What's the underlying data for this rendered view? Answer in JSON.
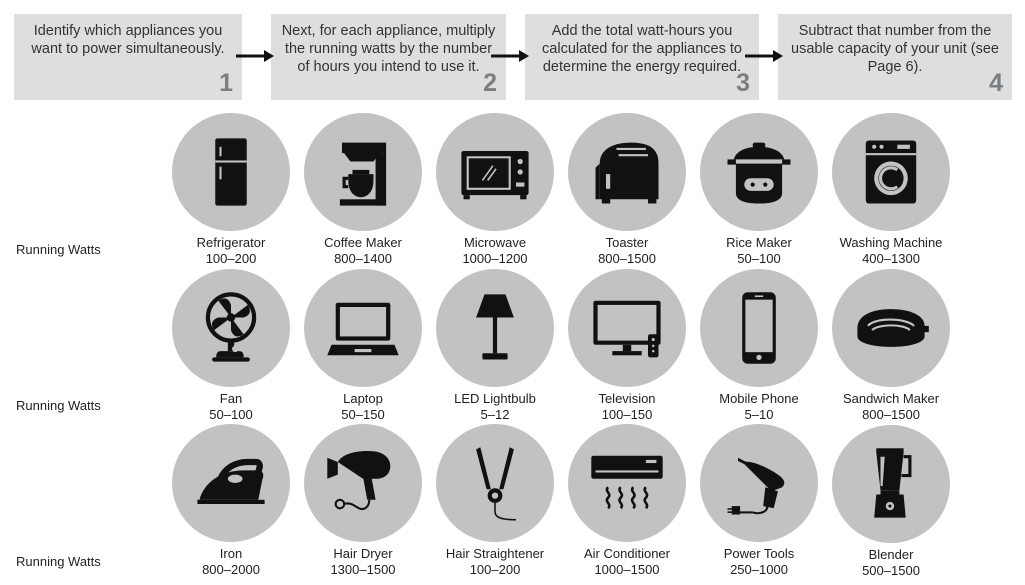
{
  "steps": [
    {
      "text": "Identify which appliances you want to power simultaneously.",
      "num": "1"
    },
    {
      "text": "Next, for each appliance, multiply the running watts by the number of hours you intend to use it.",
      "num": "2"
    },
    {
      "text": "Add the total watt-hours you calculated for the appliances to determine the energy required.",
      "num": "3"
    },
    {
      "text": "Subtract that number from the usable capacity of your unit (see Page 6).",
      "num": "4"
    }
  ],
  "row_label": "Running Watts",
  "rows": [
    [
      {
        "name": "Refrigerator",
        "watts": "100–200",
        "icon": "refrigerator-icon"
      },
      {
        "name": "Coffee Maker",
        "watts": "800–1400",
        "icon": "coffee-maker-icon"
      },
      {
        "name": "Microwave",
        "watts": "1000–1200",
        "icon": "microwave-icon"
      },
      {
        "name": "Toaster",
        "watts": "800–1500",
        "icon": "toaster-icon"
      },
      {
        "name": "Rice Maker",
        "watts": "50–100",
        "icon": "rice-maker-icon"
      },
      {
        "name": "Washing Machine",
        "watts": "400–1300",
        "icon": "washing-machine-icon"
      }
    ],
    [
      {
        "name": "Fan",
        "watts": "50–100",
        "icon": "fan-icon"
      },
      {
        "name": "Laptop",
        "watts": "50–150",
        "icon": "laptop-icon"
      },
      {
        "name": "LED Lightbulb",
        "watts": "5–12",
        "icon": "lamp-icon"
      },
      {
        "name": "Television",
        "watts": "100–150",
        "icon": "television-icon"
      },
      {
        "name": "Mobile Phone",
        "watts": "5–10",
        "icon": "mobile-phone-icon"
      },
      {
        "name": "Sandwich Maker",
        "watts": "800–1500",
        "icon": "sandwich-maker-icon"
      }
    ],
    [
      {
        "name": "Iron",
        "watts": "800–2000",
        "icon": "iron-icon"
      },
      {
        "name": "Hair Dryer",
        "watts": "1300–1500",
        "icon": "hair-dryer-icon"
      },
      {
        "name": "Hair Straightener",
        "watts": "100–200",
        "icon": "hair-straightener-icon"
      },
      {
        "name": "Air Conditioner",
        "watts": "1000–1500",
        "icon": "air-conditioner-icon"
      },
      {
        "name": "Power Tools",
        "watts": "250–1000",
        "icon": "power-drill-icon"
      },
      {
        "name": "Blender",
        "watts": "500–1500",
        "icon": "blender-icon"
      }
    ]
  ]
}
